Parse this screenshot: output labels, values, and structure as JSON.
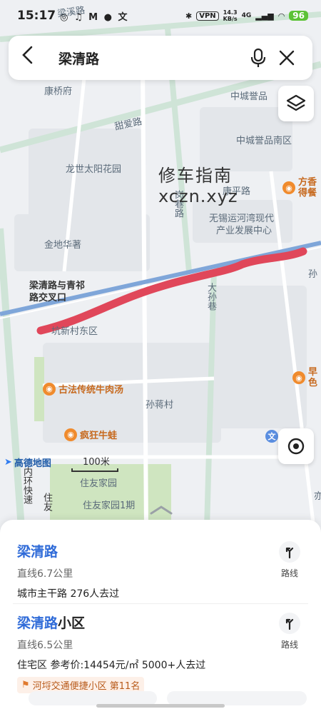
{
  "status_bar": {
    "time": "15:17",
    "left_icons": "◎ ♫ M ● 文",
    "vpn": "VPN",
    "speed_top": "14.3",
    "speed_bottom": "KB/s",
    "network": "4G",
    "battery": "96"
  },
  "search": {
    "query": "梁清路"
  },
  "map": {
    "labels": {
      "liangxi": "梁溪路",
      "kangqiaofu": "康桥府",
      "zhongchengyu": "中城誉品",
      "tianai": "甜爱路",
      "zhongchengyu_south": "中城誉品南区",
      "longshi": "龙世太阳花园",
      "kangping": "康平路",
      "gangxiang": "岗巷路",
      "wuxi_line1": "无锡运河湾现代",
      "wuxi_line2": "产业发展中心",
      "jindi": "金地华著",
      "intersection": "梁清路与青祁路交叉口",
      "xinxincun": "坑新村东区",
      "dasunxiang": "大孙巷",
      "sunjiang": "孙蒋村",
      "sunjiang_right": "孙",
      "inner_ring": "内环快速",
      "zhuyou1": "住友家园",
      "zhuyou2": "住友家园1期",
      "zhu_left": "住友",
      "fangxiang": "方香得餐",
      "zao": "早色",
      "xue": "学",
      "yi": "亦"
    },
    "pois": {
      "beef": "古法传统牛肉汤",
      "frog": "疯狂牛蛙"
    },
    "watermark_line1": "修车指南",
    "watermark_line2": "xczn.xyz",
    "logo": "高德地图",
    "scale": "100米",
    "route_color": "#e0475a"
  },
  "results": [
    {
      "name_highlight": "梁清路",
      "name_rest": "",
      "distance": "直线6.7公里",
      "meta": "城市主干路  276人去过",
      "route_label": "路线"
    },
    {
      "name_highlight": "梁清路",
      "name_rest": "小区",
      "distance": "直线6.5公里",
      "meta": "住宅区  参考价:14454元/㎡  5000+人去过",
      "rank": "河埒交通便捷小区 第11名",
      "route_label": "路线"
    }
  ]
}
